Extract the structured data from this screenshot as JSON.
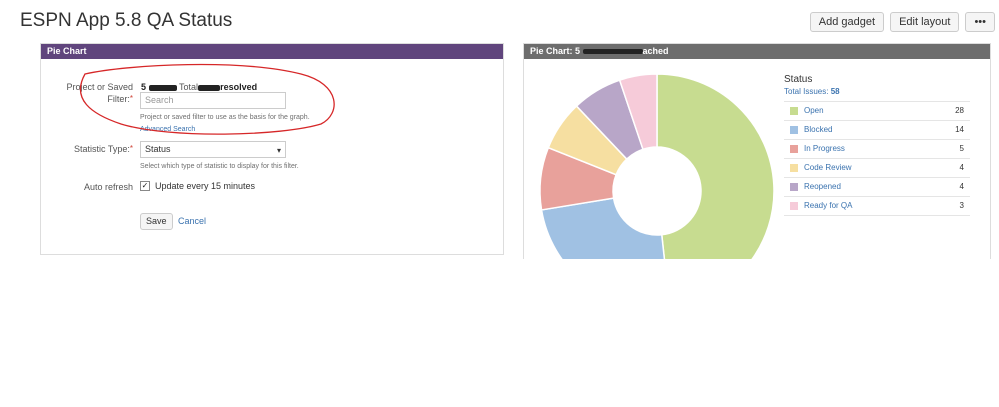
{
  "header": {
    "title": "ESPN App 5.8 QA Status",
    "add_gadget": "Add gadget",
    "edit_layout": "Edit layout",
    "more": "•••"
  },
  "config_gadget": {
    "title": "Pie Chart",
    "filter_label": "Project or Saved Filter:",
    "filter_value_prefix": "5",
    "filter_value_suffix": "resolved",
    "filter_value_middle": "Total",
    "search_placeholder": "Search",
    "filter_help": "Project or saved filter to use as the basis for the graph.",
    "advanced_search": "Advanced Search",
    "statistic_label": "Statistic Type:",
    "statistic_value": "Status",
    "statistic_help": "Select which type of statistic to display for this filter.",
    "auto_refresh_label": "Auto refresh",
    "auto_refresh_option": "Update every 15 minutes",
    "save": "Save",
    "cancel": "Cancel"
  },
  "chart_gadget": {
    "title_prefix": "Pie Chart: 5",
    "title_suffix": "ached"
  },
  "chart_data": {
    "type": "pie",
    "title": "Status",
    "total_label": "Total Issues:",
    "total": "58",
    "categories": [
      "Open",
      "Blocked",
      "In Progress",
      "Code Review",
      "Reopened",
      "Ready for QA"
    ],
    "values": [
      28,
      14,
      5,
      4,
      4,
      3
    ],
    "colors": [
      "#c7dc90",
      "#a0c1e3",
      "#e8a19b",
      "#f6dfa1",
      "#b8a6c8",
      "#f6cbd9"
    ]
  }
}
